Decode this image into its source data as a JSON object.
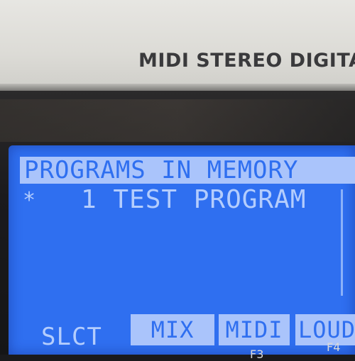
{
  "device": {
    "brand_text": "MIDI STEREO DIGITAL"
  },
  "lcd": {
    "header": "PROGRAMS IN MEMORY",
    "program_marker": "*",
    "program_entry": "1 TEST PROGRAM",
    "select_label": "SLCT",
    "softkeys": [
      "MIX",
      "MIDI",
      "LOUD"
    ]
  },
  "function_keys": [
    "F3",
    "F4"
  ],
  "colors": {
    "lcd_background": "#2f6ff0",
    "lcd_text": "#b4cdfd",
    "housing": "#e1e0dc",
    "brand_text": "#3a3a3c"
  }
}
